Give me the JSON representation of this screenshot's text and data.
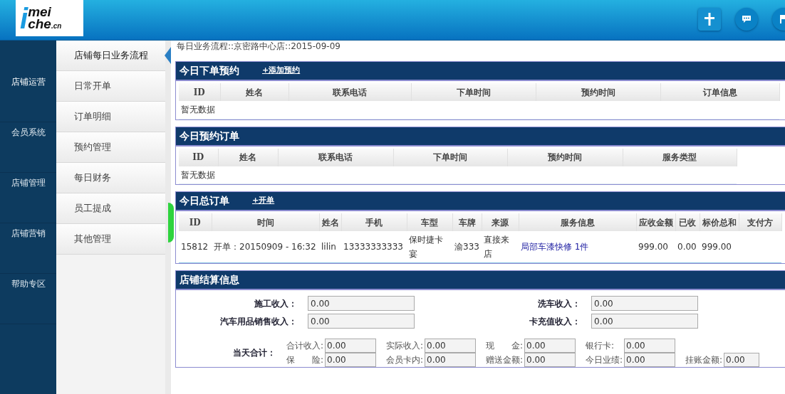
{
  "header": {
    "logo": {
      "letter": "i",
      "line1": "mei",
      "line2": "che",
      "suffix": ".cn"
    }
  },
  "nav_primary": [
    {
      "label": "店铺运营",
      "selected": true
    },
    {
      "label": "会员系统",
      "selected": false
    },
    {
      "label": "店铺管理",
      "selected": false
    },
    {
      "label": "店铺营销",
      "selected": false
    },
    {
      "label": "帮助专区",
      "selected": false
    }
  ],
  "nav_secondary": [
    {
      "label": "店铺每日业务流程",
      "selected": true
    },
    {
      "label": "日常开单",
      "selected": false
    },
    {
      "label": "订单明细",
      "selected": false
    },
    {
      "label": "预约管理",
      "selected": false
    },
    {
      "label": "每日财务",
      "selected": false
    },
    {
      "label": "员工提成",
      "selected": false
    },
    {
      "label": "其他管理",
      "selected": false
    }
  ],
  "breadcrumb": "每日业务流程::京密路中心店::2015-09-09",
  "panels": [
    {
      "kind": "table",
      "title": "今日下单预约",
      "action": "+添加预约",
      "columns": [
        "ID",
        "姓名",
        "联系电话",
        "下单时间",
        "预约时间",
        "订单信息"
      ],
      "empty_text": "暂无数据"
    },
    {
      "kind": "table",
      "title": "今日预约订单",
      "columns": [
        "ID",
        "姓名",
        "联系电话",
        "下单时间",
        "预约时间",
        "服务类型"
      ],
      "empty_text": "暂无数据"
    },
    {
      "kind": "table",
      "title": "今日总订单",
      "action": "+开单",
      "columns": [
        "ID",
        "时间",
        "姓名",
        "手机",
        "车型",
        "车牌",
        "来源",
        "服务信息",
        "应收金额",
        "已收",
        "标价总和",
        "支付方"
      ],
      "rows": [
        [
          "15812",
          "开单：20150909 - 16:32",
          "lilin",
          "13333333333",
          "保时捷卡宴",
          "渝333",
          "直接来店",
          "局部车漆快修 1件",
          "999.00",
          "0.00",
          "999.00",
          ""
        ]
      ]
    },
    {
      "kind": "form",
      "title": "店铺结算信息",
      "fields": [
        {
          "label": "施工收入：",
          "value": "0.00"
        },
        {
          "label": "洗车收入：",
          "value": "0.00"
        },
        {
          "label": "汽车用品销售收入：",
          "value": "0.00"
        },
        {
          "label": "卡充值收入：",
          "value": "0.00"
        }
      ],
      "totals_label": "当天合计：",
      "totals": [
        [
          {
            "label": "合计收入:",
            "value": "0.00"
          },
          {
            "label": "实际收入:",
            "value": "0.00"
          },
          {
            "label": "现　　金:",
            "value": "0.00"
          },
          {
            "label": "银行卡:",
            "value": "0.00"
          }
        ],
        [
          {
            "label": "保　　险:",
            "value": "0.00"
          },
          {
            "label": "会员卡内:",
            "value": "0.00"
          },
          {
            "label": "赠送金额:",
            "value": "0.00"
          },
          {
            "label": "今日业绩:",
            "value": "0.00"
          },
          {
            "label": "挂账金额:",
            "value": "0.00"
          }
        ]
      ]
    }
  ]
}
